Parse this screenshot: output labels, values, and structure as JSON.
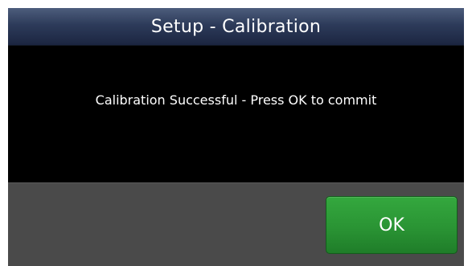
{
  "dialog": {
    "title": "Setup - Calibration",
    "message": "Calibration Successful - Press OK to commit",
    "ok_label": "OK"
  },
  "colors": {
    "title_bar": "#2d3b5a",
    "message_background": "#000000",
    "footer_background": "#4a4a4a",
    "ok_button": "#2a9434",
    "text": "#ffffff"
  }
}
